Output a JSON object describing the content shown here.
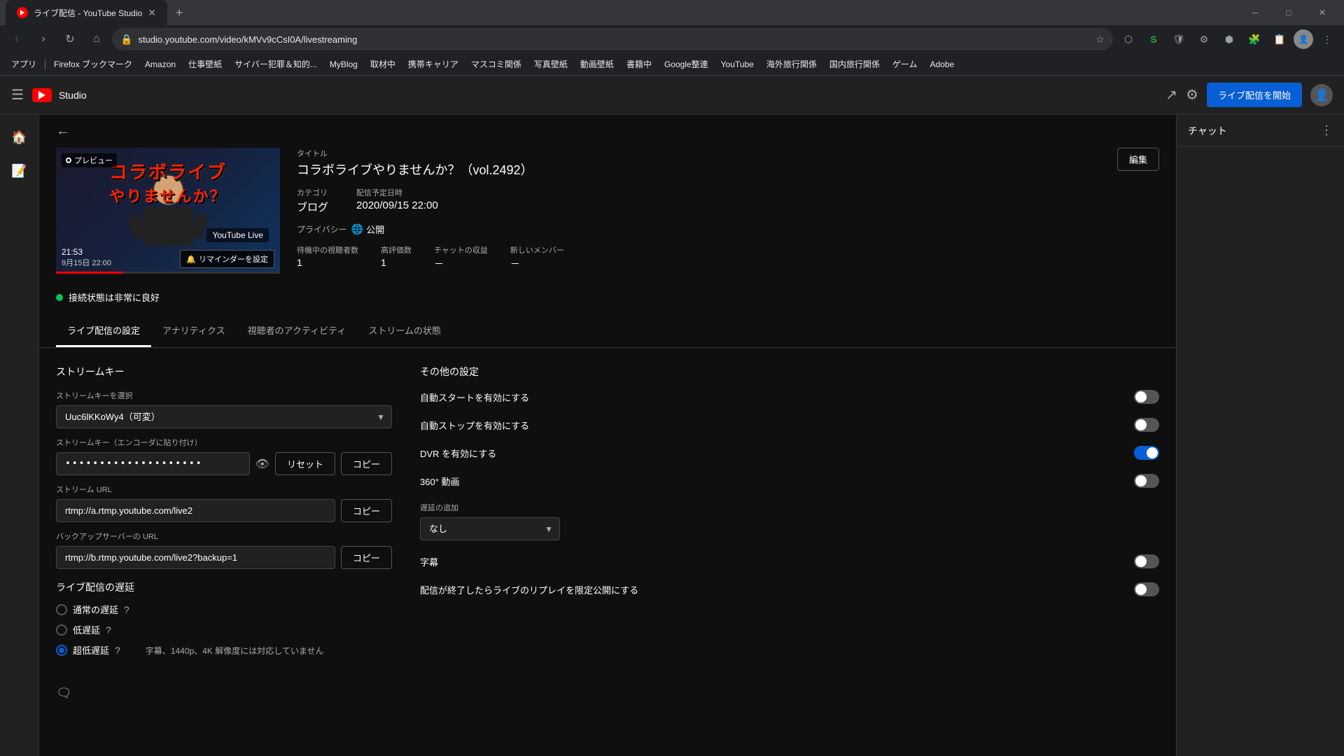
{
  "browser": {
    "tab_title": "ライブ配信 - YouTube Studio",
    "url": "studio.youtube.com/video/kMVv9cCsI0A/livestreaming",
    "bookmarks": [
      "アプリ",
      "Firefox ブックマーク",
      "Amazon",
      "仕事壁紙",
      "サイバー犯罪＆知的...",
      "MyBlog",
      "取材中",
      "携帯キャリア",
      "マスコミ関係",
      "写真壁紙",
      "動画壁紙",
      "書籍中",
      "Google整連",
      "YouTube",
      "海外旅行関係",
      "国内旅行関係",
      "ゲーム",
      "Adobe"
    ]
  },
  "header": {
    "logo_text": "Studio",
    "live_button": "ライブ配信を開始"
  },
  "video": {
    "preview_label": "プレビュー",
    "title_label": "タイトル",
    "title_value": "コラボライブやりませんか？（vol.2492）",
    "category_label": "カテゴリ",
    "category_value": "ブログ",
    "privacy_label": "プライバシー",
    "privacy_value": "公開",
    "schedule_label": "配信予定日時",
    "schedule_value": "2020/09/15 22:00",
    "edit_button": "編集",
    "thumb_time": "21:53",
    "thumb_date": "9月15日 22:00",
    "thumb_reminder": "リマインダーを設定",
    "thumb_title_line1": "コラボライブ",
    "thumb_title_line2": "やりませんか？",
    "thumb_subtitle": "YouTube Live",
    "stats": {
      "waiting_label": "待機中の視聴者数",
      "waiting_value": "1",
      "likes_label": "高評価数",
      "likes_value": "1",
      "chat_label": "チャットの収益",
      "chat_value": "－",
      "members_label": "新しいメンバー",
      "members_value": "－"
    }
  },
  "connection": {
    "status_text": "接続状態は非常に良好"
  },
  "tabs": {
    "items": [
      {
        "label": "ライブ配信の設定",
        "active": true
      },
      {
        "label": "アナリティクス",
        "active": false
      },
      {
        "label": "視聴者のアクティビティ",
        "active": false
      },
      {
        "label": "ストリームの状態",
        "active": false
      }
    ]
  },
  "stream_key_section": {
    "title": "ストリームキー",
    "select_label": "ストリームキーを選択",
    "select_value": "Uuc6lKKoWy4（可変）",
    "key_label": "ストリームキー（エンコーダに貼り付け）",
    "key_value": "••••••••••••••••••••",
    "reset_btn": "リセット",
    "copy_btn": "コピー",
    "url_label": "ストリーム URL",
    "url_value": "rtmp://a.rtmp.youtube.com/live2",
    "url_copy_btn": "コピー",
    "backup_label": "バックアップサーバーの URL",
    "backup_value": "rtmp://b.rtmp.youtube.com/live2?backup=1",
    "backup_copy_btn": "コピー"
  },
  "delay_section": {
    "title": "ライブ配信の遅延",
    "options": [
      {
        "label": "通常の遅延",
        "has_help": true,
        "selected": false
      },
      {
        "label": "低遅延",
        "has_help": true,
        "selected": false
      },
      {
        "label": "超低遅延",
        "has_help": true,
        "selected": true
      }
    ],
    "ultra_low_note": "字幕、1440p、4K 解像度には対応していません"
  },
  "other_settings": {
    "title": "その他の設定",
    "toggles": [
      {
        "label": "自動スタートを有効にする",
        "on": false
      },
      {
        "label": "自動ストップを有効にする",
        "on": false
      },
      {
        "label": "DVR を有効にする",
        "on": true
      },
      {
        "label": "360° 動画",
        "on": false
      }
    ],
    "delay_label": "遅延の追加",
    "delay_value": "なし",
    "caption_toggle": {
      "label": "字幕",
      "on": false
    },
    "replay_toggle": {
      "label": "配信が終了したらライブのリプレイを限定公開にする",
      "on": false
    }
  },
  "chat": {
    "title": "チャット"
  }
}
